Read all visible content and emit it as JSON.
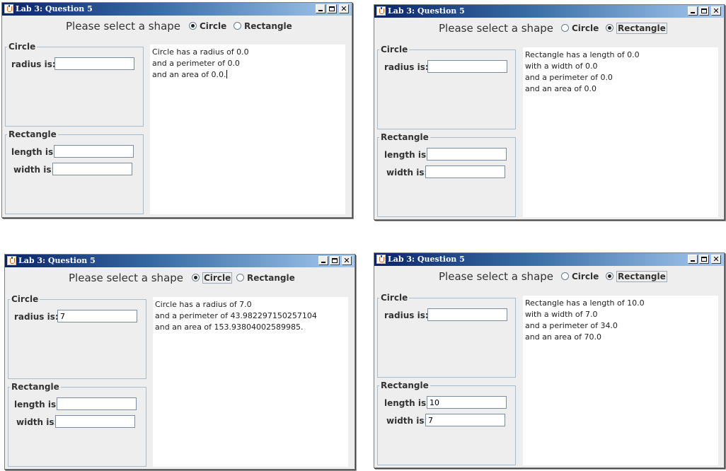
{
  "windows": [
    {
      "title": "Lab 3: Question 5",
      "prompt": "Please select a shape",
      "radio_circle": "Circle",
      "radio_rectangle": "Rectangle",
      "selected": "circle",
      "circle_group": "Circle",
      "radius_label": "radius is:",
      "radius_value": "",
      "rect_group": "Rectangle",
      "length_label": "length is:",
      "length_value": "",
      "width_label": "width is:",
      "width_value": "",
      "output": [
        "Circle has a radius of 0.0",
        "and a perimeter of 0.0",
        "and an area of 0.0."
      ]
    },
    {
      "title": "Lab 3: Question 5",
      "prompt": "Please select a shape",
      "radio_circle": "Circle",
      "radio_rectangle": "Rectangle",
      "selected": "rectangle",
      "circle_group": "Circle",
      "radius_label": "radius is:",
      "radius_value": "",
      "rect_group": "Rectangle",
      "length_label": "length is:",
      "length_value": "",
      "width_label": "width is:",
      "width_value": "",
      "output": [
        "Rectangle has a length of 0.0",
        "with a width of 0.0",
        "and a perimeter of 0.0",
        "and an area of 0.0"
      ]
    },
    {
      "title": "Lab 3: Question 5",
      "prompt": "Please select a shape",
      "radio_circle": "Circle",
      "radio_rectangle": "Rectangle",
      "selected": "circle",
      "circle_group": "Circle",
      "radius_label": "radius is:",
      "radius_value": "7",
      "rect_group": "Rectangle",
      "length_label": "length is:",
      "length_value": "",
      "width_label": "width is:",
      "width_value": "",
      "output": [
        "Circle has a radius of 7.0",
        "and a perimeter of 43.982297150257104",
        "and an area of 153.93804002589985."
      ]
    },
    {
      "title": "Lab 3: Question 5",
      "prompt": "Please select a shape",
      "radio_circle": "Circle",
      "radio_rectangle": "Rectangle",
      "selected": "rectangle",
      "circle_group": "Circle",
      "radius_label": "radius is:",
      "radius_value": "",
      "rect_group": "Rectangle",
      "length_label": "length is:",
      "length_value": "10",
      "width_label": "width is:",
      "width_value": "7",
      "output": [
        "Rectangle has a length of 10.0",
        "with a width of 7.0",
        "and a perimeter of 34.0",
        "and an area of 70.0"
      ]
    }
  ]
}
